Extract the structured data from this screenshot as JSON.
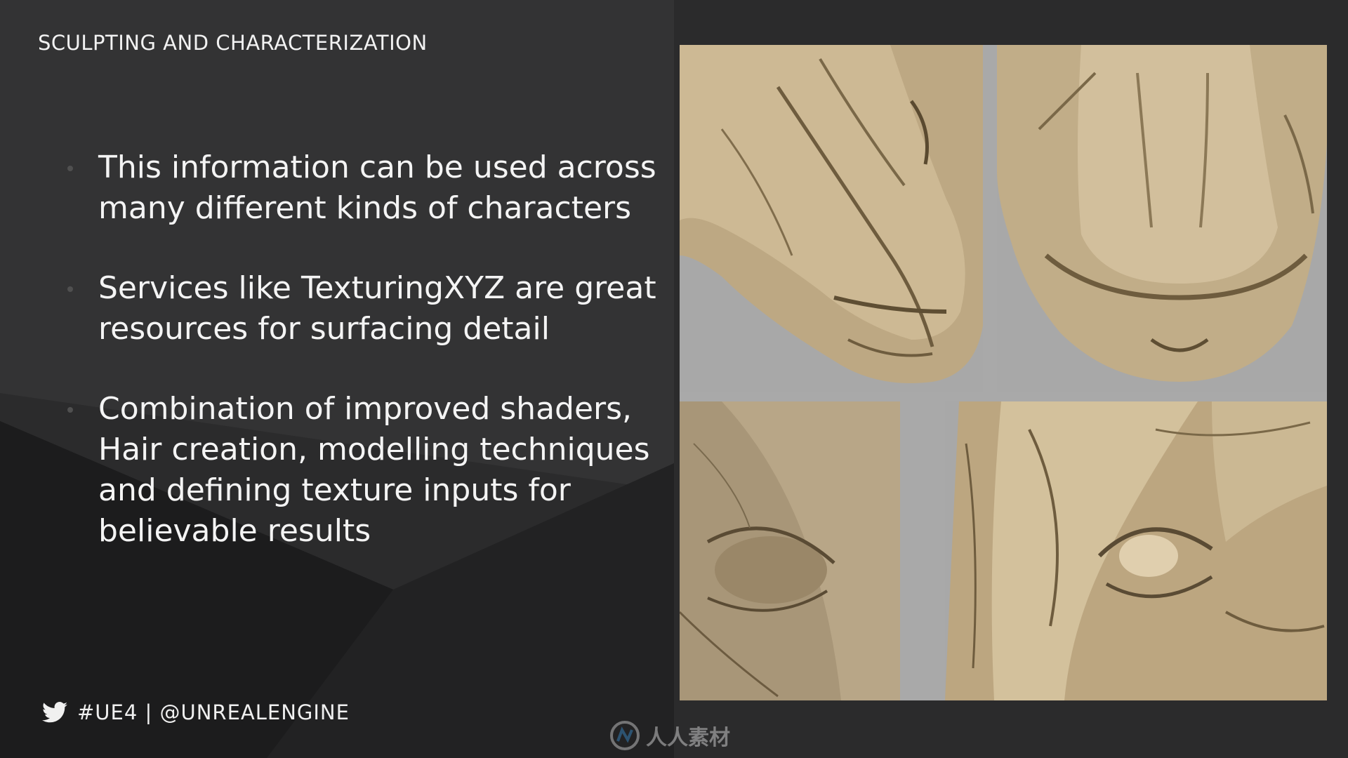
{
  "slide": {
    "title": "SCULPTING AND CHARACTERIZATION",
    "bullets": [
      {
        "text": "This information can be used across\nmany different kinds of characters"
      },
      {
        "text": "Services like TexturingXYZ are great\nresources for surfacing detail"
      },
      {
        "text": "Combination of improved shaders,\nHair creation, modelling techniques\nand defining texture inputs for\nbelievable results"
      }
    ]
  },
  "footer": {
    "icon": "twitter-bird-icon",
    "text": "#UE4 | @UNREALENGINE"
  },
  "watermark": {
    "icon": "watermark-logo-icon",
    "text": "人人素材"
  },
  "colors": {
    "background": "#2b2b2c",
    "text": "#f4f4f4",
    "sculpt_tone": "#c8b490",
    "panel_gray": "#a9a9a9"
  }
}
